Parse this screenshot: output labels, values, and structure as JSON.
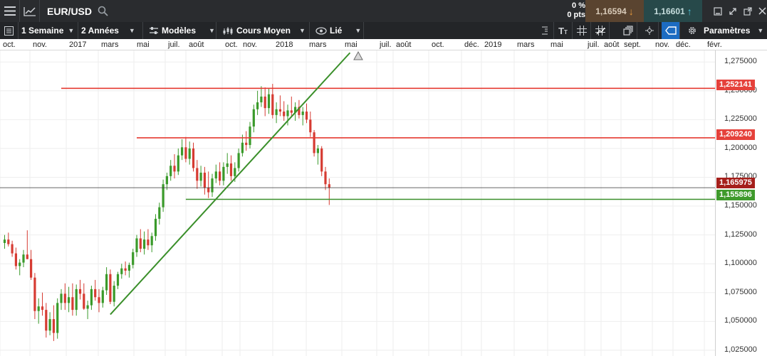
{
  "topbar": {
    "symbol": "EUR/USD",
    "change_pct": "0 %",
    "change_pts": "0 pts",
    "bid": "1,16594",
    "ask": "1,16601",
    "bid_arrow": "↓",
    "ask_arrow": "↑"
  },
  "toolbar": {
    "interval": "1 Semaine",
    "range": "2 Années",
    "templates": "Modèles",
    "chart_type": "Cours Moyen",
    "link": "Lié",
    "settings": "Paramètres"
  },
  "colors": {
    "up": "#3a9a2a",
    "down": "#d63b32",
    "resistance": "#e53a30",
    "support": "#3a8f2a",
    "current": "#a51f1b"
  },
  "axis": {
    "months": [
      "oct.",
      "nov.",
      "2017",
      "mars",
      "mai",
      "juil.",
      "août",
      "oct.",
      "nov.",
      "2018",
      "mars",
      "mai",
      "juil.",
      "août",
      "oct.",
      "déc.",
      "2019",
      "mars",
      "mai",
      "juil.",
      "août",
      "sept.",
      "nov.",
      "déc.",
      "févr."
    ],
    "price_ticks": [
      "1,275000",
      "1,250000",
      "1,225000",
      "1,200000",
      "1,175000",
      "1,150000",
      "1,125000",
      "1,100000",
      "1,075000",
      "1,050000",
      "1,025000"
    ]
  },
  "price_labels": {
    "resistance_1": "1,252141",
    "resistance_2": "1,209240",
    "current": "1,165975",
    "support": "1,155896"
  },
  "chart_data": {
    "type": "candlestick",
    "symbol": "EUR/USD",
    "interval": "1 Semaine",
    "ylim": [
      1.02,
      1.285
    ],
    "ticks": [
      1.275,
      1.25,
      1.225,
      1.2,
      1.175,
      1.15,
      1.125,
      1.1,
      1.075,
      1.05,
      1.025
    ],
    "horizontal_lines": [
      {
        "name": "resistance_1",
        "value": 1.252141,
        "from_index": 15,
        "to_index": 170
      },
      {
        "name": "resistance_2",
        "value": 1.20924,
        "from_index": 35,
        "to_index": 170
      },
      {
        "name": "current",
        "value": 1.165975,
        "from_index": 0,
        "to_index": 170
      },
      {
        "name": "support",
        "value": 1.155896,
        "from_index": 48,
        "to_index": 170
      }
    ],
    "trend_line": {
      "from_index": 28,
      "from_value": 1.056,
      "to_index": 91.5,
      "to_value": 1.283
    },
    "candles": [
      [
        1.118,
        1.125,
        1.113,
        1.121
      ],
      [
        1.121,
        1.127,
        1.115,
        1.117
      ],
      [
        1.117,
        1.12,
        1.106,
        1.109
      ],
      [
        1.109,
        1.114,
        1.095,
        1.098
      ],
      [
        1.098,
        1.104,
        1.09,
        1.101
      ],
      [
        1.101,
        1.112,
        1.097,
        1.108
      ],
      [
        1.108,
        1.129,
        1.104,
        1.104
      ],
      [
        1.104,
        1.112,
        1.086,
        1.088
      ],
      [
        1.088,
        1.092,
        1.052,
        1.059
      ],
      [
        1.059,
        1.07,
        1.048,
        1.063
      ],
      [
        1.063,
        1.075,
        1.055,
        1.06
      ],
      [
        1.06,
        1.066,
        1.036,
        1.042
      ],
      [
        1.042,
        1.058,
        1.038,
        1.052
      ],
      [
        1.052,
        1.064,
        1.033,
        1.04
      ],
      [
        1.04,
        1.07,
        1.035,
        1.066
      ],
      [
        1.066,
        1.078,
        1.06,
        1.074
      ],
      [
        1.074,
        1.083,
        1.06,
        1.066
      ],
      [
        1.066,
        1.08,
        1.058,
        1.071
      ],
      [
        1.071,
        1.083,
        1.055,
        1.06
      ],
      [
        1.06,
        1.082,
        1.055,
        1.078
      ],
      [
        1.078,
        1.086,
        1.069,
        1.074
      ],
      [
        1.074,
        1.083,
        1.06,
        1.061
      ],
      [
        1.061,
        1.068,
        1.052,
        1.064
      ],
      [
        1.064,
        1.081,
        1.06,
        1.078
      ],
      [
        1.078,
        1.086,
        1.068,
        1.071
      ],
      [
        1.071,
        1.078,
        1.058,
        1.066
      ],
      [
        1.066,
        1.08,
        1.062,
        1.077
      ],
      [
        1.077,
        1.097,
        1.073,
        1.091
      ],
      [
        1.091,
        1.095,
        1.065,
        1.067
      ],
      [
        1.067,
        1.085,
        1.063,
        1.081
      ],
      [
        1.081,
        1.093,
        1.078,
        1.091
      ],
      [
        1.091,
        1.1,
        1.087,
        1.096
      ],
      [
        1.096,
        1.102,
        1.09,
        1.094
      ],
      [
        1.094,
        1.101,
        1.088,
        1.099
      ],
      [
        1.099,
        1.113,
        1.096,
        1.11
      ],
      [
        1.11,
        1.125,
        1.106,
        1.122
      ],
      [
        1.122,
        1.13,
        1.11,
        1.113
      ],
      [
        1.113,
        1.128,
        1.108,
        1.121
      ],
      [
        1.121,
        1.13,
        1.112,
        1.116
      ],
      [
        1.116,
        1.127,
        1.11,
        1.124
      ],
      [
        1.124,
        1.143,
        1.12,
        1.139
      ],
      [
        1.139,
        1.153,
        1.134,
        1.149
      ],
      [
        1.149,
        1.173,
        1.145,
        1.169
      ],
      [
        1.169,
        1.179,
        1.164,
        1.176
      ],
      [
        1.176,
        1.19,
        1.172,
        1.185
      ],
      [
        1.185,
        1.195,
        1.174,
        1.18
      ],
      [
        1.18,
        1.2,
        1.177,
        1.194
      ],
      [
        1.194,
        1.208,
        1.19,
        1.201
      ],
      [
        1.201,
        1.21,
        1.188,
        1.191
      ],
      [
        1.191,
        1.206,
        1.186,
        1.2
      ],
      [
        1.2,
        1.205,
        1.18,
        1.183
      ],
      [
        1.183,
        1.19,
        1.165,
        1.172
      ],
      [
        1.172,
        1.185,
        1.167,
        1.179
      ],
      [
        1.179,
        1.184,
        1.16,
        1.166
      ],
      [
        1.166,
        1.18,
        1.157,
        1.162
      ],
      [
        1.162,
        1.178,
        1.158,
        1.174
      ],
      [
        1.174,
        1.186,
        1.17,
        1.18
      ],
      [
        1.18,
        1.188,
        1.168,
        1.172
      ],
      [
        1.172,
        1.188,
        1.168,
        1.184
      ],
      [
        1.184,
        1.196,
        1.178,
        1.187
      ],
      [
        1.187,
        1.194,
        1.172,
        1.176
      ],
      [
        1.176,
        1.188,
        1.171,
        1.183
      ],
      [
        1.183,
        1.2,
        1.18,
        1.196
      ],
      [
        1.196,
        1.212,
        1.193,
        1.205
      ],
      [
        1.205,
        1.215,
        1.198,
        1.203
      ],
      [
        1.203,
        1.223,
        1.2,
        1.219
      ],
      [
        1.219,
        1.238,
        1.214,
        1.234
      ],
      [
        1.234,
        1.25,
        1.229,
        1.24
      ],
      [
        1.24,
        1.254,
        1.236,
        1.245
      ],
      [
        1.245,
        1.253,
        1.228,
        1.235
      ],
      [
        1.235,
        1.252,
        1.23,
        1.247
      ],
      [
        1.247,
        1.256,
        1.226,
        1.229
      ],
      [
        1.229,
        1.24,
        1.222,
        1.234
      ],
      [
        1.234,
        1.246,
        1.228,
        1.232
      ],
      [
        1.232,
        1.241,
        1.224,
        1.228
      ],
      [
        1.228,
        1.238,
        1.22,
        1.233
      ],
      [
        1.233,
        1.245,
        1.228,
        1.231
      ],
      [
        1.231,
        1.24,
        1.224,
        1.236
      ],
      [
        1.236,
        1.242,
        1.226,
        1.229
      ],
      [
        1.229,
        1.236,
        1.22,
        1.232
      ],
      [
        1.232,
        1.239,
        1.222,
        1.225
      ],
      [
        1.225,
        1.232,
        1.21,
        1.214
      ],
      [
        1.214,
        1.216,
        1.193,
        1.196
      ],
      [
        1.196,
        1.203,
        1.186,
        1.2
      ],
      [
        1.2,
        1.202,
        1.176,
        1.18
      ],
      [
        1.18,
        1.184,
        1.164,
        1.169
      ],
      [
        1.169,
        1.174,
        1.151,
        1.166
      ]
    ]
  }
}
